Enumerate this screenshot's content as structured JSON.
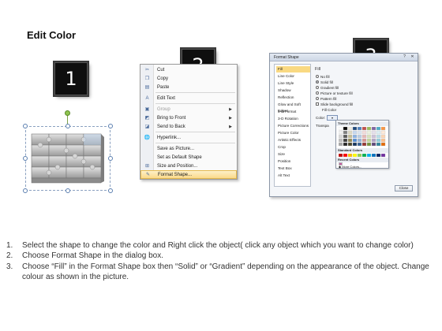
{
  "title": "Edit Color",
  "steps": {
    "one": "1",
    "two": "2",
    "three": "3"
  },
  "context_menu": {
    "items": [
      {
        "label": "Cut",
        "icon": "scissors-icon",
        "disabled": false
      },
      {
        "label": "Copy",
        "icon": "copy-icon",
        "disabled": false
      },
      {
        "label": "Paste",
        "icon": "paste-icon",
        "disabled": false
      },
      {
        "label": "Edit Text",
        "icon": "edit-text-icon",
        "disabled": false
      },
      {
        "label": "Group",
        "icon": "group-icon",
        "disabled": true
      },
      {
        "label": "Bring to Front",
        "icon": "bring-front-icon",
        "disabled": false
      },
      {
        "label": "Send to Back",
        "icon": "send-back-icon",
        "disabled": false
      },
      {
        "label": "Hyperlink...",
        "icon": "hyperlink-icon",
        "disabled": false
      },
      {
        "label": "Save as Picture...",
        "icon": "",
        "disabled": false
      },
      {
        "label": "Set as Default Shape",
        "icon": "",
        "disabled": false
      },
      {
        "label": "Size and Position...",
        "icon": "size-icon",
        "disabled": false
      },
      {
        "label": "Format Shape...",
        "icon": "format-shape-icon",
        "disabled": false,
        "highlighted": true
      }
    ]
  },
  "format_dialog": {
    "title": "Format Shape",
    "nav": [
      "Fill",
      "Line Color",
      "Line Style",
      "Shadow",
      "Reflection",
      "Glow and Soft Edges",
      "3-D Format",
      "3-D Rotation",
      "Picture Corrections",
      "Picture Color",
      "Artistic Effects",
      "Crop",
      "Size",
      "Position",
      "Text Box",
      "Alt Text"
    ],
    "section": "Fill",
    "options": [
      "No fill",
      "Solid fill",
      "Gradient fill",
      "Picture or texture fill",
      "Pattern fill",
      "Slide background fill"
    ],
    "fill_color_label": "Fill Color",
    "color_label": "Color:",
    "transparency_label": "Transpa",
    "palette": {
      "theme_label": "Theme Colors",
      "standard_label": "Standard Colors",
      "recent_label": "Recent Colors",
      "more_label": "More Colors..."
    },
    "close_label": "Close"
  },
  "instructions": [
    {
      "num": "1.",
      "text": "Select the shape to change the color and Right click the object( click any object which you want to change color)"
    },
    {
      "num": "2.",
      "text": "Choose Format Shape in the dialog box."
    },
    {
      "num": "3.",
      "text": "Choose “Fill” in the Format Shape box then “Solid” or “Gradient” depending on the appearance of the object. Change colour as shown in the picture."
    }
  ]
}
